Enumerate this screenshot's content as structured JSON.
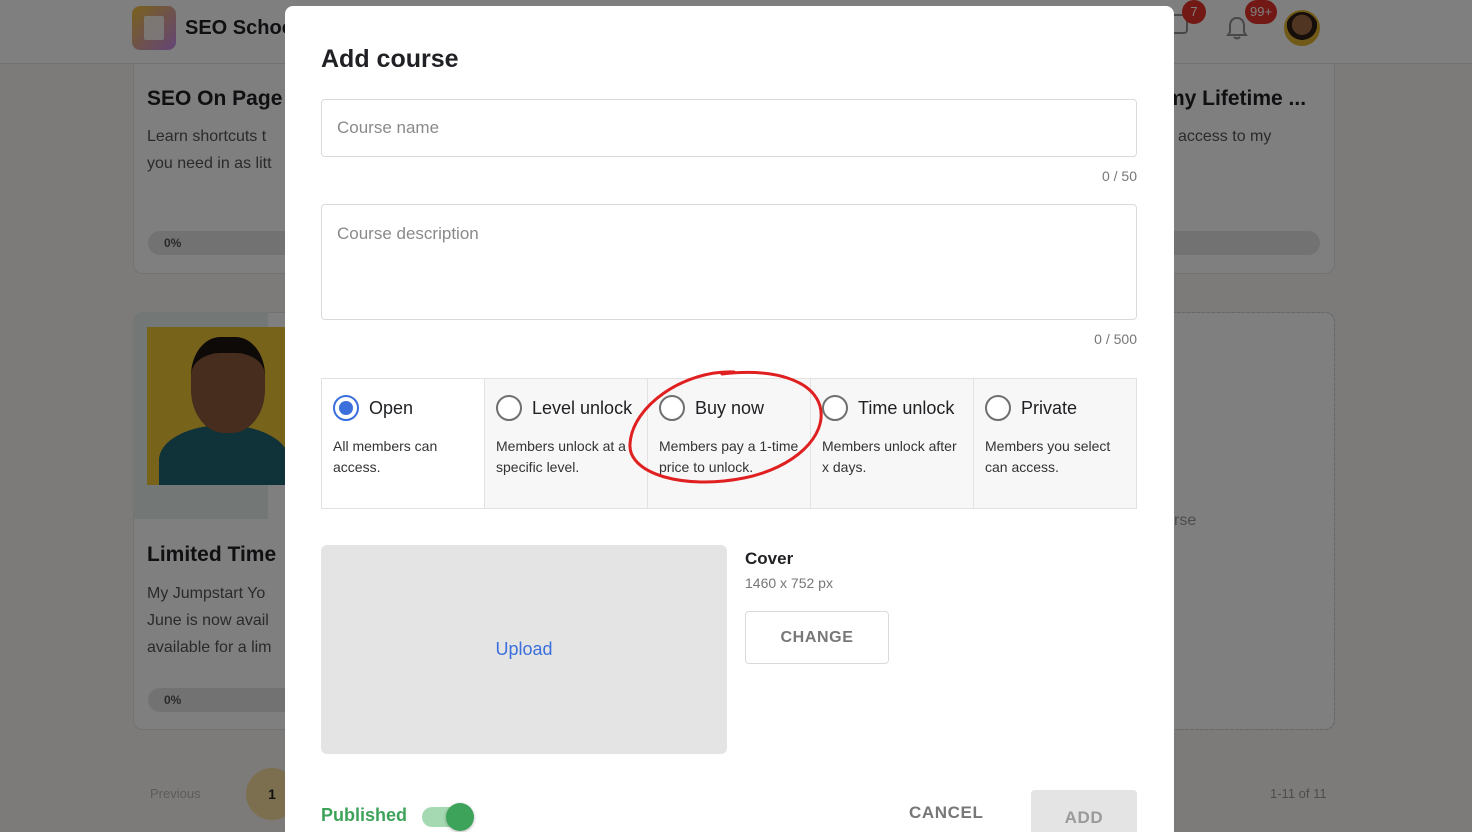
{
  "background": {
    "group_name": "SEO School",
    "chat_badge": "7",
    "notification_badge": "99+",
    "course1": {
      "title": "SEO On Page",
      "desc_line1": "Learn shortcuts t",
      "desc_line2": "you need in as litt",
      "progress": "0%"
    },
    "course_right": {
      "title": "my Lifetime ...",
      "desc": "access to my"
    },
    "course2": {
      "title": "Limited Time",
      "desc_line1": "My Jumpstart Yo",
      "desc_line2": "June is now avail",
      "desc_line3": "available for a lim",
      "progress": "0%"
    },
    "add_course_tile": "rse",
    "pager": {
      "previous": "Previous",
      "page": "1",
      "count": "1-11 of 11"
    }
  },
  "modal": {
    "title": "Add course",
    "course_name": {
      "placeholder": "Course name",
      "value": "",
      "counter": "0 / 50"
    },
    "course_description": {
      "placeholder": "Course description",
      "value": "",
      "counter": "0 / 500"
    },
    "access_options": [
      {
        "label": "Open",
        "desc": "All members can access.",
        "selected": true
      },
      {
        "label": "Level unlock",
        "desc": "Members unlock at a specific level.",
        "selected": false
      },
      {
        "label": "Buy now",
        "desc": "Members pay a 1-time price to unlock.",
        "selected": false
      },
      {
        "label": "Time unlock",
        "desc": "Members unlock after x days.",
        "selected": false
      },
      {
        "label": "Private",
        "desc": "Members you select can access.",
        "selected": false
      }
    ],
    "upload_label": "Upload",
    "cover": {
      "title": "Cover",
      "size": "1460 x 752 px",
      "change_label": "CHANGE"
    },
    "published_label": "Published",
    "published": true,
    "cancel_label": "CANCEL",
    "add_label": "ADD"
  },
  "colors": {
    "accent": "#3a6fdc",
    "published": "#3ea35a",
    "badge": "#e4322a",
    "annotation": "#e02020"
  }
}
